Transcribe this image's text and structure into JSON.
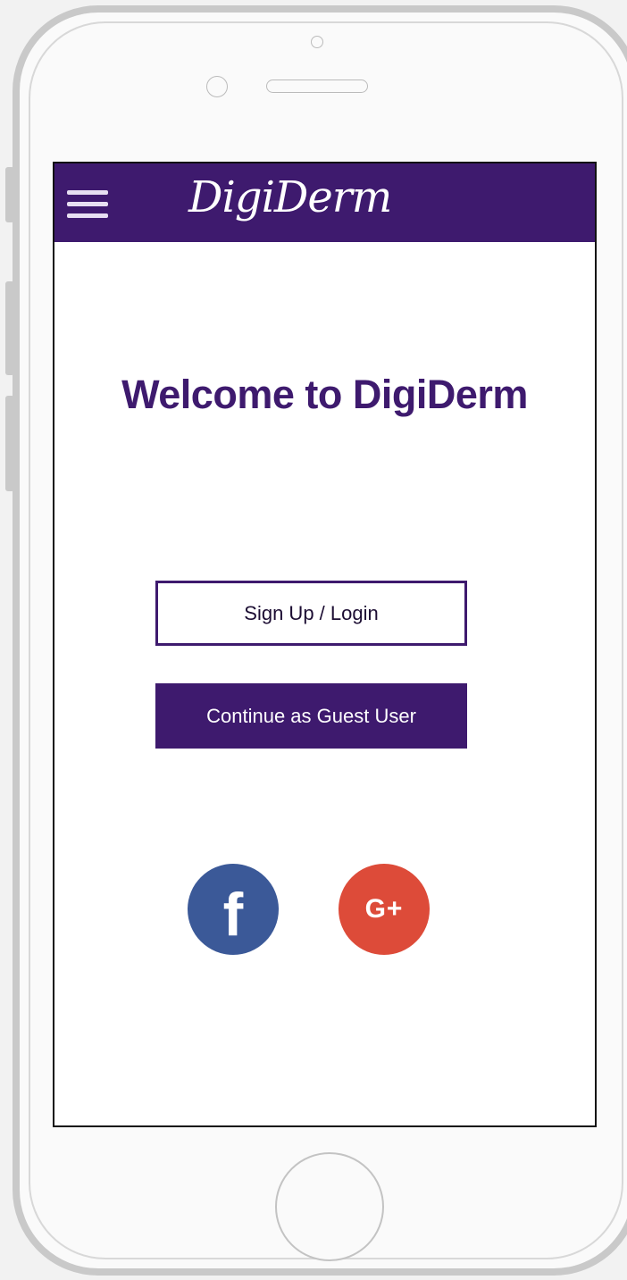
{
  "app": {
    "brand_name": "DigiDerm",
    "colors": {
      "primary": "#3e1a6e",
      "facebook": "#3b5998",
      "google": "#dd4b39",
      "menu_icon": "#e7dff2"
    }
  },
  "header": {
    "menu_icon": "hamburger-menu-icon",
    "brand_logo_text": "DigiDerm"
  },
  "main": {
    "title": "Welcome to DigiDerm",
    "sign_up_login_label": "Sign Up / Login",
    "guest_label": "Continue as Guest User"
  },
  "social": {
    "facebook": {
      "icon": "facebook-icon",
      "glyph": "f"
    },
    "google": {
      "icon": "google-plus-icon",
      "glyph": "G+"
    }
  }
}
